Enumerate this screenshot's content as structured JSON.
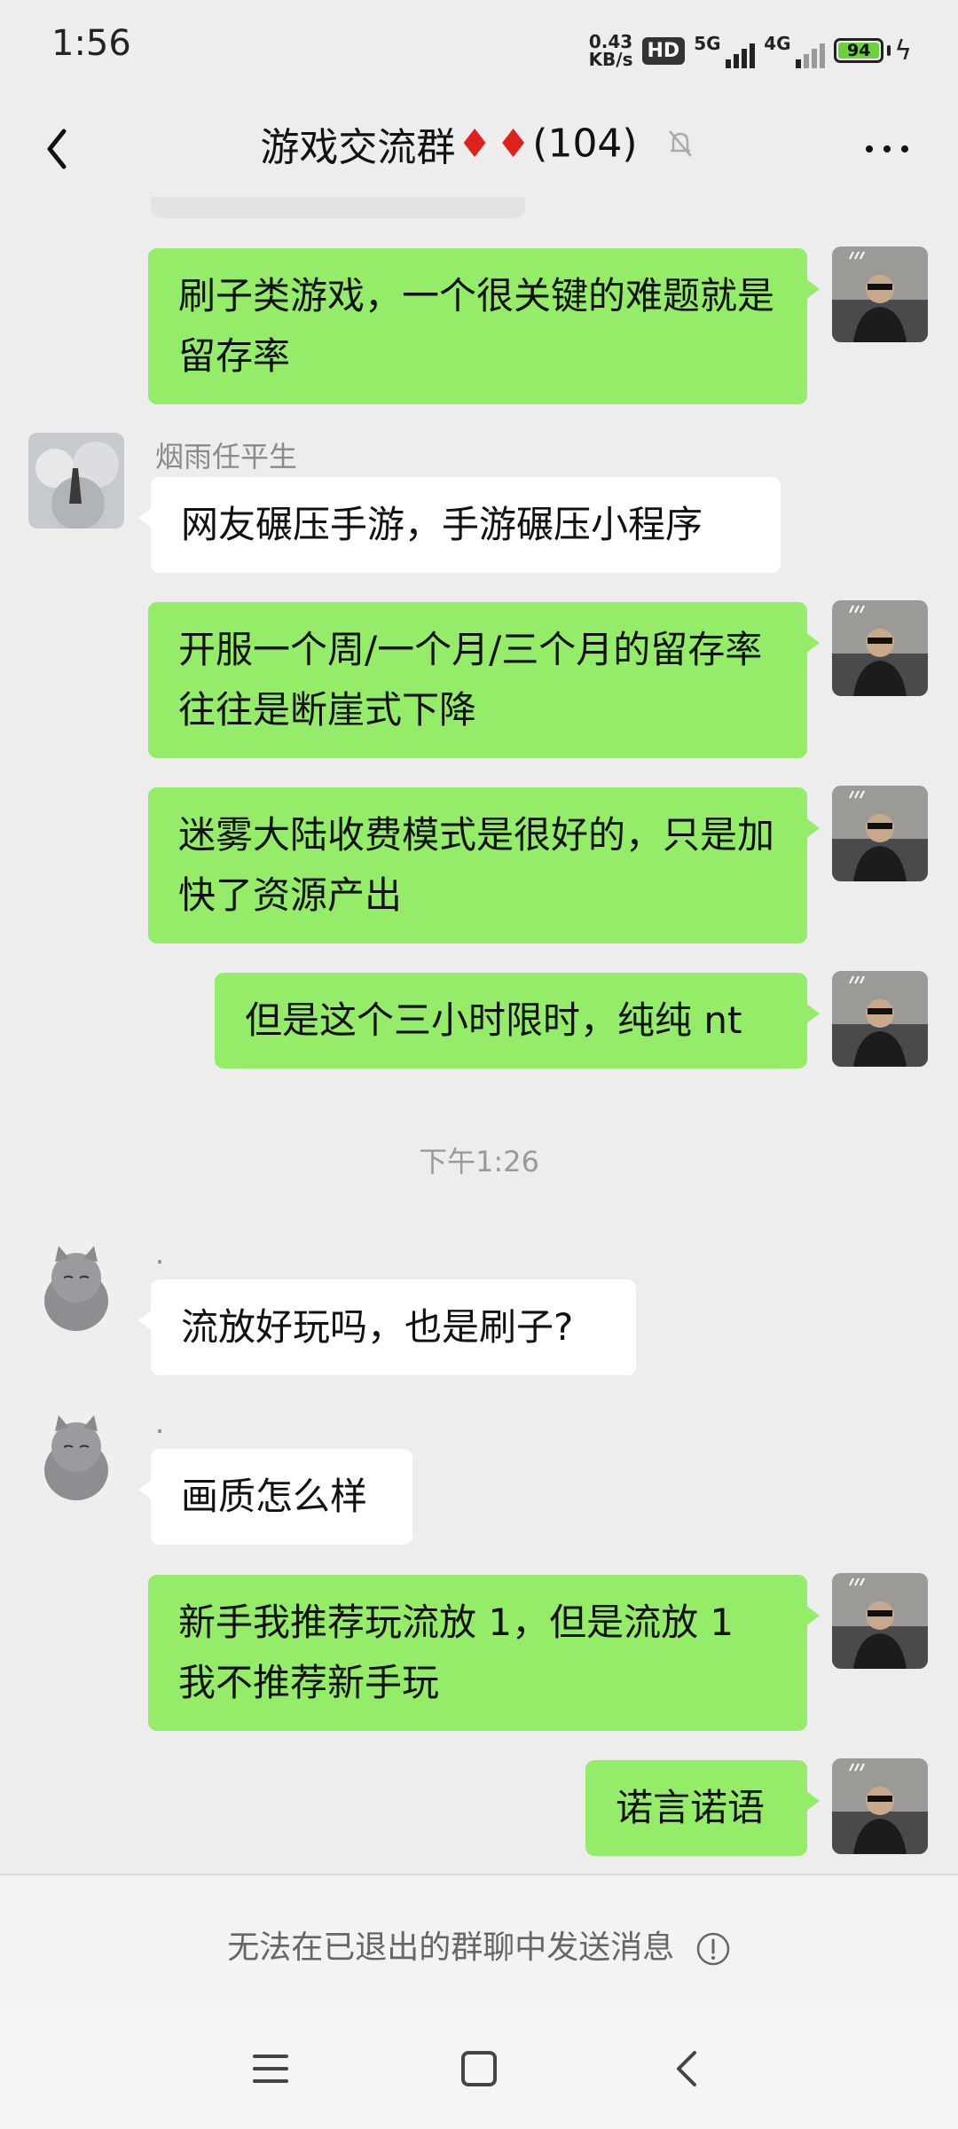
{
  "status": {
    "time": "1:56",
    "net_speed_value": "0.43",
    "net_speed_unit": "KB/s",
    "hd_label": "HD",
    "sig1_label": "5G",
    "sig2_label": "4G",
    "battery": "94"
  },
  "header": {
    "title": "游戏交流群",
    "member_count": "(104)"
  },
  "messages": [
    {
      "text": "刷子类游戏，一个很关键的难题就是留存率"
    },
    {
      "sender": "烟雨任平生",
      "text": "网友碾压手游，手游碾压小程序"
    },
    {
      "text": "开服一个周/一个月/三个月的留存率往往是断崖式下降"
    },
    {
      "text": "迷雾大陆收费模式是很好的，只是加快了资源产出"
    },
    {
      "text": "但是这个三小时限时，纯纯 nt"
    },
    {
      "sender": ".",
      "text": "流放好玩吗，也是刷子?"
    },
    {
      "sender": ".",
      "text": "画质怎么样"
    },
    {
      "text": "新手我推荐玩流放 1，但是流放 1 我不推荐新手玩"
    },
    {
      "text": "诺言诺语"
    }
  ],
  "timestamp": "下午1:26",
  "footer": {
    "notice": "无法在已退出的群聊中发送消息"
  },
  "colors": {
    "my_bubble": "#95ec69",
    "other_bubble": "#ffffff",
    "background": "#ededed",
    "diamond": "#e0201a"
  }
}
